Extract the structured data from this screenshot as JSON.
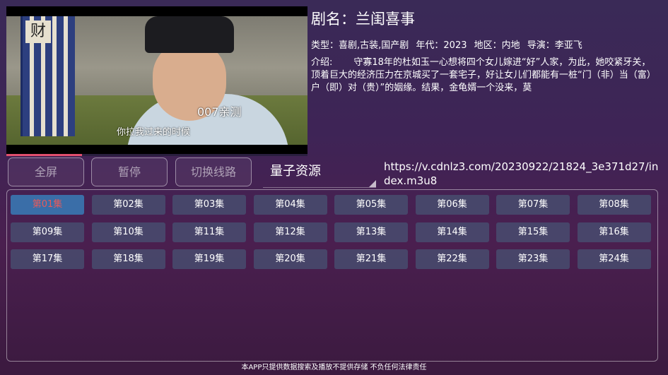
{
  "player": {
    "watermark": "007亲测",
    "subtitle": "你拉我过来的时候",
    "banner_char": "财",
    "progress": 0.25
  },
  "info": {
    "title": "剧名：兰闺喜事",
    "meta": {
      "type": "类型：喜剧,古装,国产剧",
      "year": "年代：2023",
      "region": "地区：内地",
      "director": "导演：李亚飞"
    },
    "desc_label": "介绍:",
    "desc_text": "守寡18年的杜如玉一心想将四个女儿嫁进“好”人家，为此，她咬紧牙关，顶着巨大的经济压力在京城买了一套宅子，好让女儿们都能有一桩“门（非）当（富）户（即）对（贵）”的姻缘。结果，金龟婿一个没来，莫"
  },
  "controls": {
    "fullscreen": "全屏",
    "pause": "暂停",
    "switch_line": "切换线路"
  },
  "source": {
    "selected": "量子资源",
    "url": "https://v.cdnlz3.com/20230922/21824_3e371d27/index.m3u8"
  },
  "episodes": [
    "第01集",
    "第02集",
    "第03集",
    "第04集",
    "第05集",
    "第06集",
    "第07集",
    "第08集",
    "第09集",
    "第10集",
    "第11集",
    "第12集",
    "第13集",
    "第14集",
    "第15集",
    "第16集",
    "第17集",
    "第18集",
    "第19集",
    "第20集",
    "第21集",
    "第22集",
    "第23集",
    "第24集"
  ],
  "active_episode": 0,
  "footer": "本APP只提供数据搜索及播放不提供存储 不负任何法律责任",
  "colors": {
    "accent_red": "#e85a5a",
    "episode_bg": "#484c6e",
    "active_bg": "#3a6ea8"
  }
}
